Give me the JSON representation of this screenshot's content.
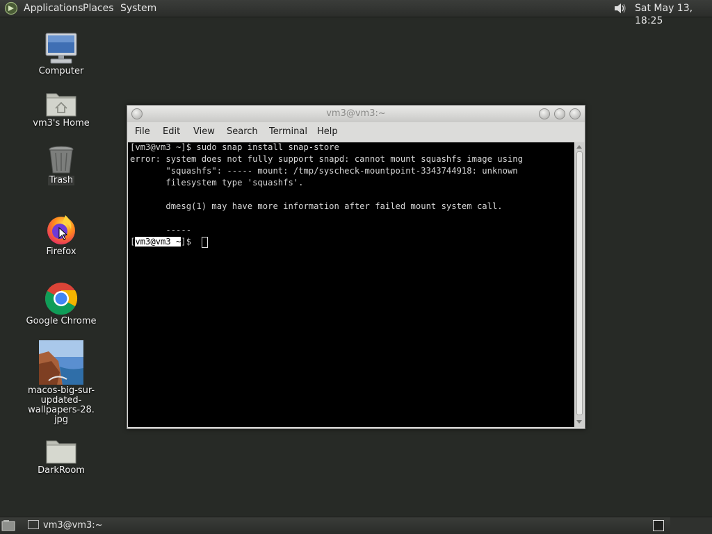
{
  "top_panel": {
    "menus": [
      "Applications",
      "Places",
      "System"
    ],
    "clock": "Sat May 13, 18:25",
    "icons": {
      "logo": "distro-logo-icon",
      "volume": "volume-icon"
    }
  },
  "desktop": {
    "icons": [
      {
        "label": "Computer",
        "icon": "computer-icon"
      },
      {
        "label": "vm3's Home",
        "icon": "home-folder-icon"
      },
      {
        "label": "Trash",
        "icon": "trash-icon"
      },
      {
        "label": "Firefox",
        "icon": "firefox-icon"
      },
      {
        "label": "Google Chrome",
        "icon": "chrome-icon"
      },
      {
        "label": "macos-big-sur-updated-wallpapers-28.jpg",
        "label_lines": [
          "macos-big-sur-",
          "updated-wallpapers-28.",
          "jpg"
        ],
        "icon": "image-file-icon"
      },
      {
        "label": "DarkRoom",
        "icon": "folder-icon"
      }
    ]
  },
  "terminal": {
    "title": "vm3@vm3:~",
    "menu": [
      "File",
      "Edit",
      "View",
      "Search",
      "Terminal",
      "Help"
    ],
    "lines": [
      "[vm3@vm3 ~]$ sudo snap install snap-store",
      "error: system does not fully support snapd: cannot mount squashfs image using",
      "       \"squashfs\": ----- mount: /tmp/syscheck-mountpoint-3343744918: unknown",
      "       filesystem type 'squashfs'.",
      "",
      "       dmesg(1) may have more information after failed mount system call.",
      "",
      "       -----"
    ],
    "prompt": {
      "open": "[",
      "user_host": "vm3@vm3 ~",
      "close": "]$"
    }
  },
  "bottom_panel": {
    "task_label": "vm3@vm3:~",
    "icons": {
      "show_desktop": "show-desktop-icon",
      "task": "terminal-icon",
      "workspace": "workspace-icon"
    }
  },
  "colors": {
    "desktop_bg": "#272a26",
    "panel_bg": "#2b2d2a",
    "terminal_bg": "#000000",
    "terminal_fg": "#d6d6d6",
    "window_chrome": "#d8d8d6"
  }
}
